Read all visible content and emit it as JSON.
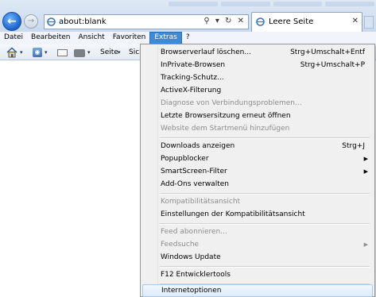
{
  "browser": {
    "address_text": "about:blank",
    "address_icons": "⚲ ▾ ↻ ✕",
    "tab_label": "Leere Seite",
    "tab_close": "✕",
    "back_glyph": "←",
    "forward_glyph": "→"
  },
  "menubar": [
    "Datei",
    "Bearbeiten",
    "Ansicht",
    "Favoriten",
    "Extras",
    "?"
  ],
  "toolbar": {
    "home_icon": "home-icon",
    "feed_icon": "rss-feed-icon",
    "mail_icon": "mail-icon",
    "print_icon": "printer-icon",
    "page_label": "Seite",
    "security_label": "Sich",
    "arrow": "▾"
  },
  "extras_menu": {
    "items": [
      {
        "label": "Browserverlauf löschen...",
        "shortcut": "Strg+Umschalt+Entf",
        "enabled": true
      },
      {
        "label": "InPrivate-Browsen",
        "shortcut": "Strg+Umschalt+P",
        "enabled": true
      },
      {
        "label": "Tracking-Schutz...",
        "shortcut": "",
        "enabled": true
      },
      {
        "label": "ActiveX-Filterung",
        "shortcut": "",
        "enabled": true
      },
      {
        "label": "Diagnose von Verbindungsproblemen...",
        "shortcut": "",
        "enabled": false
      },
      {
        "label": "Letzte Browsersitzung erneut öffnen",
        "shortcut": "",
        "enabled": true
      },
      {
        "label": "Website dem Startmenü hinzufügen",
        "shortcut": "",
        "enabled": false
      },
      {
        "label": "Downloads anzeigen",
        "shortcut": "Strg+J",
        "enabled": true
      },
      {
        "label": "Popupblocker",
        "shortcut": "",
        "submenu": true,
        "enabled": true
      },
      {
        "label": "SmartScreen-Filter",
        "shortcut": "",
        "submenu": true,
        "enabled": true
      },
      {
        "label": "Add-Ons verwalten",
        "shortcut": "",
        "enabled": true
      },
      {
        "label": "Kompatibilitätsansicht",
        "shortcut": "",
        "enabled": false
      },
      {
        "label": "Einstellungen der Kompatibilitätsansicht",
        "shortcut": "",
        "enabled": true
      },
      {
        "label": "Feed abonnieren...",
        "shortcut": "",
        "enabled": false
      },
      {
        "label": "Feedsuche",
        "shortcut": "",
        "submenu": true,
        "enabled": false
      },
      {
        "label": "Windows Update",
        "shortcut": "",
        "enabled": true
      },
      {
        "label": "F12 Entwicklertools",
        "shortcut": "",
        "enabled": true
      },
      {
        "label": "Internetoptionen",
        "shortcut": "",
        "enabled": true,
        "highlighted": true
      }
    ],
    "submenu_arrow": "▶"
  },
  "colors": {
    "menu_active": "#3d8bd8",
    "menu_background": "#f0f0f0",
    "disabled_text": "#8d8d8d"
  }
}
